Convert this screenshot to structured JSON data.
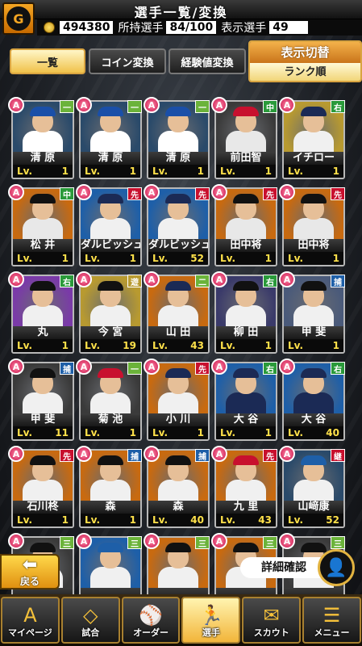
{
  "header": {
    "title": "選手一覧/変換",
    "logo_icon": "giants-logo-icon",
    "coins": "494380",
    "owned_label": "所持選手",
    "owned_value": "84/100",
    "shown_label": "表示選手",
    "shown_value": "49"
  },
  "tabs": [
    {
      "label": "一覧",
      "active": true
    },
    {
      "label": "コイン変換",
      "active": false
    },
    {
      "label": "経験値変換",
      "active": false
    }
  ],
  "display_toggle": {
    "label": "表示切替",
    "value": "ランク順"
  },
  "players": [
    {
      "rank": "A",
      "pos": "一",
      "name": "清 原",
      "lv": "1",
      "cap": "#1a4fa8",
      "uni": "#ffffff",
      "bg": "#2a4a6a",
      "pcol": "#6bb33a"
    },
    {
      "rank": "A",
      "pos": "一",
      "name": "清 原",
      "lv": "1",
      "cap": "#1a4fa8",
      "uni": "#ffffff",
      "bg": "#2a4a6a",
      "pcol": "#6bb33a"
    },
    {
      "rank": "A",
      "pos": "一",
      "name": "清 原",
      "lv": "1",
      "cap": "#1a4fa8",
      "uni": "#ffffff",
      "bg": "#2a4a6a",
      "pcol": "#6bb33a"
    },
    {
      "rank": "A",
      "pos": "中",
      "name": "前田智",
      "lv": "1",
      "cap": "#c8102e",
      "uni": "#e8e8e8",
      "bg": "#3a3a3a",
      "pcol": "#2a9a3a"
    },
    {
      "rank": "A",
      "pos": "右",
      "name": "イチロー",
      "lv": "1",
      "cap": "#1b2a55",
      "uni": "#f0f0f0",
      "bg": "#b89a30",
      "pcol": "#2a9a3a"
    },
    {
      "rank": "A",
      "pos": "中",
      "name": "松 井",
      "lv": "1",
      "cap": "#111111",
      "uni": "#e8e8e8",
      "bg": "#c86a10",
      "pcol": "#2a9a3a"
    },
    {
      "rank": "A",
      "pos": "先",
      "name": "ダルビッシュ",
      "lv": "1",
      "cap": "#1b2a55",
      "uni": "#f0f0f0",
      "bg": "#1e5fa8",
      "pcol": "#c8102e"
    },
    {
      "rank": "A",
      "pos": "先",
      "name": "ダルビッシュ",
      "lv": "52",
      "cap": "#1b2a55",
      "uni": "#f0f0f0",
      "bg": "#1e5fa8",
      "pcol": "#c8102e"
    },
    {
      "rank": "A",
      "pos": "先",
      "name": "田中将",
      "lv": "1",
      "cap": "#111111",
      "uni": "#e8e8e8",
      "bg": "#c86a10",
      "pcol": "#c8102e"
    },
    {
      "rank": "A",
      "pos": "先",
      "name": "田中将",
      "lv": "1",
      "cap": "#111111",
      "uni": "#e8e8e8",
      "bg": "#c86a10",
      "pcol": "#c8102e"
    },
    {
      "rank": "A",
      "pos": "右",
      "name": "丸",
      "lv": "1",
      "cap": "#111111",
      "uni": "#f0f0f0",
      "bg": "#7a3aa8",
      "pcol": "#2a9a3a"
    },
    {
      "rank": "A",
      "pos": "遊",
      "name": "今 宮",
      "lv": "19",
      "cap": "#111111",
      "uni": "#f0f0f0",
      "bg": "#b89a30",
      "pcol": "#b89a30"
    },
    {
      "rank": "A",
      "pos": "二",
      "name": "山 田",
      "lv": "43",
      "cap": "#1b2a55",
      "uni": "#f0f0f0",
      "bg": "#c86a10",
      "pcol": "#6bb33a"
    },
    {
      "rank": "A",
      "pos": "右",
      "name": "柳 田",
      "lv": "1",
      "cap": "#111111",
      "uni": "#f0f0f0",
      "bg": "#3a3a6a",
      "pcol": "#2a9a3a"
    },
    {
      "rank": "A",
      "pos": "捕",
      "name": "甲 斐",
      "lv": "1",
      "cap": "#111111",
      "uni": "#f0f0f0",
      "bg": "#4a5a7a",
      "pcol": "#1e5fa8"
    },
    {
      "rank": "A",
      "pos": "捕",
      "name": "甲 斐",
      "lv": "11",
      "cap": "#111111",
      "uni": "#f0f0f0",
      "bg": "#3a3a3a",
      "pcol": "#1e5fa8"
    },
    {
      "rank": "A",
      "pos": "一",
      "name": "菊 池",
      "lv": "1",
      "cap": "#c8102e",
      "uni": "#f0f0f0",
      "bg": "#3a3a3a",
      "pcol": "#6bb33a"
    },
    {
      "rank": "A",
      "pos": "先",
      "name": "小 川",
      "lv": "1",
      "cap": "#1b2a55",
      "uni": "#f0f0f0",
      "bg": "#c86a10",
      "pcol": "#c8102e"
    },
    {
      "rank": "A",
      "pos": "右",
      "name": "大 谷",
      "lv": "1",
      "cap": "#1b2a55",
      "uni": "#1b2a55",
      "bg": "#1e5fa8",
      "pcol": "#2a9a3a"
    },
    {
      "rank": "A",
      "pos": "右",
      "name": "大 谷",
      "lv": "40",
      "cap": "#1b2a55",
      "uni": "#1b2a55",
      "bg": "#1e5fa8",
      "pcol": "#2a9a3a"
    },
    {
      "rank": "A",
      "pos": "先",
      "name": "石川柊",
      "lv": "1",
      "cap": "#111111",
      "uni": "#f0f0f0",
      "bg": "#c86a10",
      "pcol": "#c8102e"
    },
    {
      "rank": "A",
      "pos": "捕",
      "name": "森",
      "lv": "1",
      "cap": "#111111",
      "uni": "#f0f0f0",
      "bg": "#c86a10",
      "pcol": "#1e5fa8"
    },
    {
      "rank": "A",
      "pos": "捕",
      "name": "森",
      "lv": "40",
      "cap": "#111111",
      "uni": "#f0f0f0",
      "bg": "#c86a10",
      "pcol": "#1e5fa8"
    },
    {
      "rank": "A",
      "pos": "先",
      "name": "九 里",
      "lv": "43",
      "cap": "#c8102e",
      "uni": "#f0f0f0",
      "bg": "#c86a10",
      "pcol": "#c8102e"
    },
    {
      "rank": "A",
      "pos": "継",
      "name": "山﨑康",
      "lv": "52",
      "cap": "#1e5fa8",
      "uni": "#f0f0f0",
      "bg": "#2a4a6a",
      "pcol": "#c8102e"
    },
    {
      "rank": "A",
      "pos": "三",
      "name": "",
      "lv": "",
      "cap": "#111111",
      "uni": "#f0f0f0",
      "bg": "#3a3a3a",
      "pcol": "#6bb33a"
    },
    {
      "rank": "A",
      "pos": "三",
      "name": "",
      "lv": "",
      "cap": "#1e5fa8",
      "uni": "#f0f0f0",
      "bg": "#1e5fa8",
      "pcol": "#6bb33a"
    },
    {
      "rank": "A",
      "pos": "三",
      "name": "",
      "lv": "",
      "cap": "#111111",
      "uni": "#f0f0f0",
      "bg": "#c86a10",
      "pcol": "#6bb33a"
    },
    {
      "rank": "A",
      "pos": "三",
      "name": "",
      "lv": "",
      "cap": "#111111",
      "uni": "#f0f0f0",
      "bg": "#c86a10",
      "pcol": "#6bb33a"
    },
    {
      "rank": "A",
      "pos": "三",
      "name": "",
      "lv": "",
      "cap": "#111111",
      "uni": "#f0f0f0",
      "bg": "#3a3a3a",
      "pcol": "#6bb33a"
    }
  ],
  "lv_prefix": "Lv.",
  "back_button": {
    "label": "戻る"
  },
  "detail_button": {
    "label": "詳細確認"
  },
  "nav": [
    {
      "label": "マイページ",
      "icon": "mypage-icon",
      "glyph": "A",
      "active": false
    },
    {
      "label": "試合",
      "icon": "stadium-icon",
      "glyph": "◇",
      "active": false
    },
    {
      "label": "オーダー",
      "icon": "order-icon",
      "glyph": "⚾",
      "active": false
    },
    {
      "label": "選手",
      "icon": "player-icon",
      "glyph": "🏃",
      "active": true
    },
    {
      "label": "スカウト",
      "icon": "scout-icon",
      "glyph": "✉",
      "active": false
    },
    {
      "label": "メニュー",
      "icon": "menu-icon",
      "glyph": "☰",
      "active": false
    }
  ]
}
